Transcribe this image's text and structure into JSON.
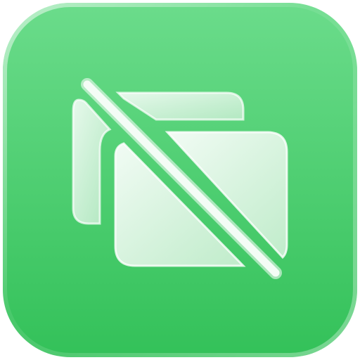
{
  "app_icon": {
    "icon": "no-windows-icon",
    "colors": {
      "background_top": "#6bdc8b",
      "background_bottom": "#33c159",
      "glyph_fill": "#e9f8ec",
      "glyph_stroke": "#ffffff",
      "slash": "#f4fcf6"
    }
  }
}
